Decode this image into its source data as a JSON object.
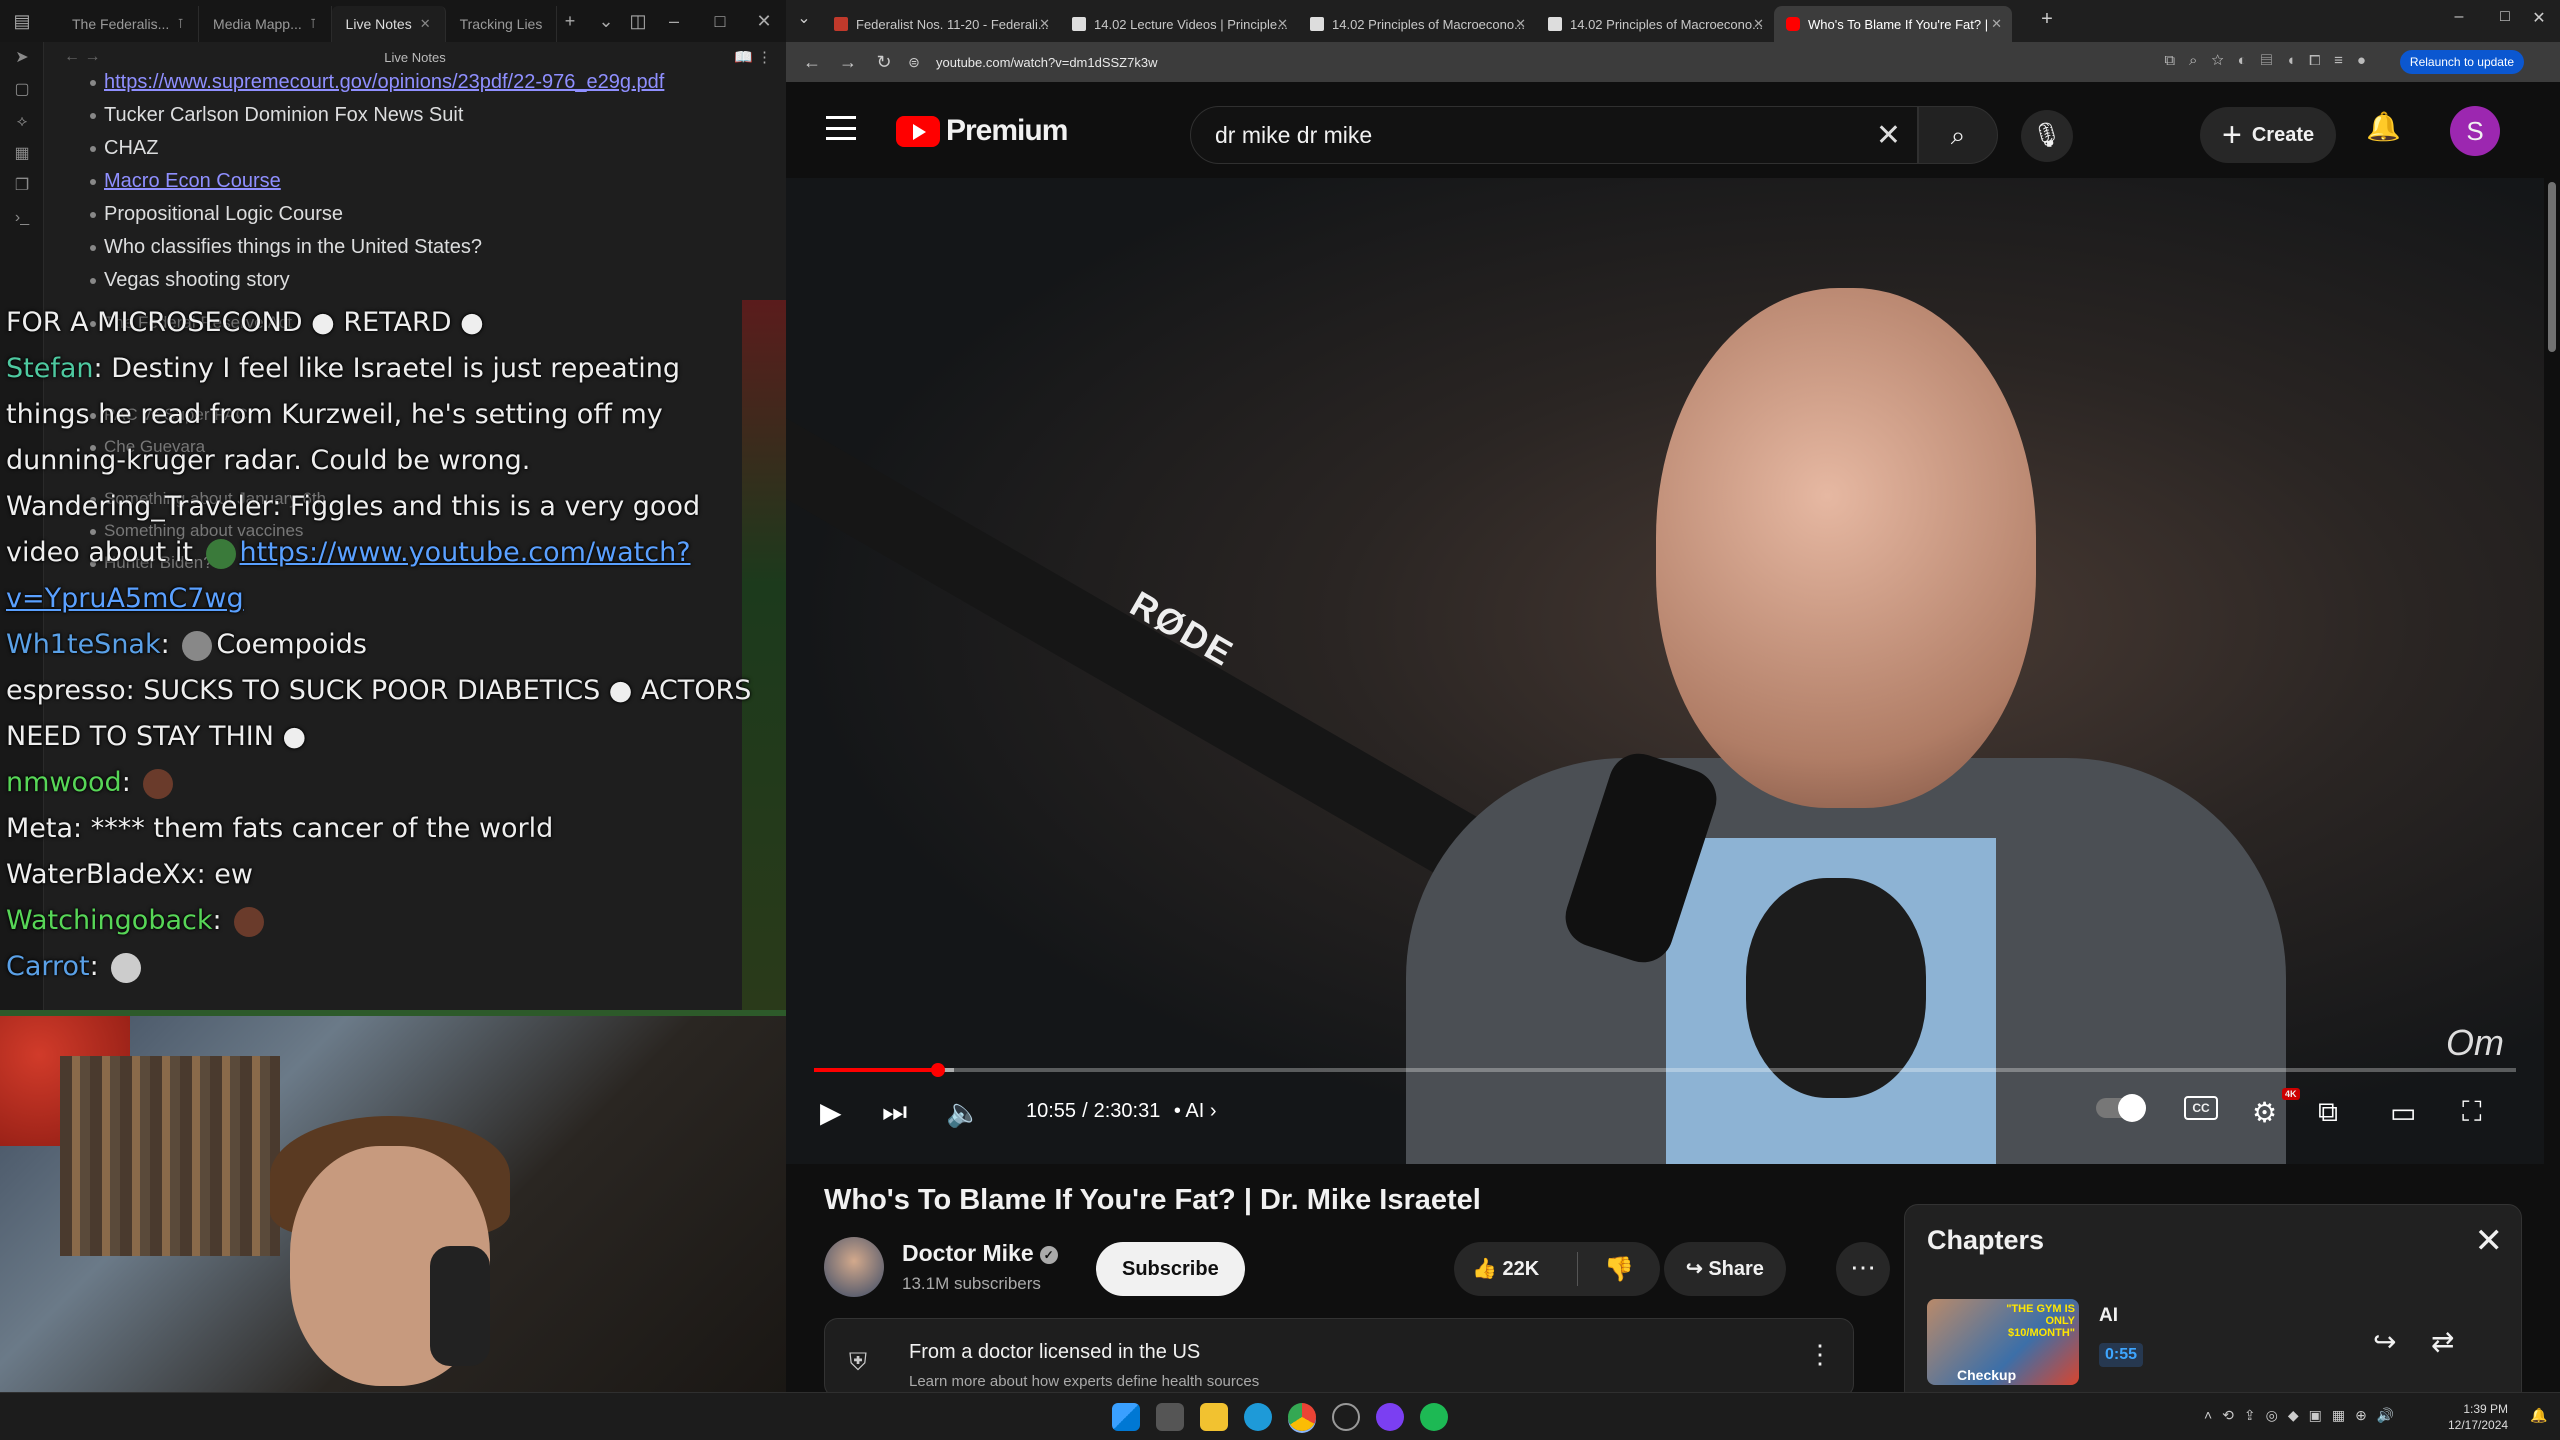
{
  "obsidian": {
    "tabs": [
      {
        "label": "The Federalis...",
        "pinned": true
      },
      {
        "label": "Media Mapp...",
        "pinned": true
      },
      {
        "label": "Live Notes",
        "active": true
      },
      {
        "label": "Tracking Lies"
      }
    ],
    "note_title": "Live Notes",
    "notes": [
      {
        "text": "https://www.supremecourt.gov/opinions/23pdf/22-976_e29g.pdf",
        "link": true
      },
      {
        "text": "Tucker Carlson Dominion Fox News Suit"
      },
      {
        "text": "CHAZ"
      },
      {
        "text": "Macro Econ Course",
        "link": true
      },
      {
        "text": "Propositional Logic Course"
      },
      {
        "text": "Who classifies things in the United States?"
      },
      {
        "text": "Vegas shooting story"
      }
    ],
    "faded_notes": [
      "The Federal Reserve Act",
      "PAC vs Super PAC",
      "Che Guevara",
      "Something about January 6th",
      "Something about vaccines",
      "Hunter Biden?"
    ]
  },
  "stream_chat": [
    {
      "user": "",
      "message": "FOR A MICROSECOND ● RETARD ●"
    },
    {
      "user": "Stefan",
      "message": "Destiny I feel like Israetel is just repeating things he read from Kurzweil, he's setting off my dunning-kruger radar. Could be wrong."
    },
    {
      "user": "Wandering_Traveler",
      "message": "Figgles and this is a very good video about it",
      "link": "https://www.youtube.com/watch?v=YpruA5mC7wg"
    },
    {
      "user": "Wh1teSnak",
      "message": "Coempoids"
    },
    {
      "user": "espresso",
      "message": "SUCKS TO SUCK POOR DIABETICS ● ACTORS NEED TO STAY THIN ●"
    },
    {
      "user": "nmwood",
      "message": ""
    },
    {
      "user": "Meta",
      "message": "**** them fats cancer of the world"
    },
    {
      "user": "WaterBladeXx",
      "message": "ew"
    },
    {
      "user": "Watchingoback",
      "message": ""
    },
    {
      "user": "Carrot",
      "message": ""
    }
  ],
  "chrome": {
    "tabs": [
      {
        "label": "Federalist Nos. 11-20 - Federali...",
        "color": "#c0392b"
      },
      {
        "label": "14.02 Lecture Videos | Principle...",
        "color": "#e0e0e0"
      },
      {
        "label": "14.02 Principles of Macroecono...",
        "color": "#e0e0e0"
      },
      {
        "label": "14.02 Principles of Macroecono...",
        "color": "#e0e0e0"
      },
      {
        "label": "Who's To Blame If You're Fat? |",
        "color": "#ff0000",
        "active": true
      }
    ],
    "url": "youtube.com/watch?v=dm1dSSZ7k3w",
    "relaunch": "Relaunch to update"
  },
  "youtube": {
    "logo": "Premium",
    "search_query": "dr mike dr mike",
    "create": "Create",
    "avatar": "S",
    "player": {
      "current_time": "10:55",
      "duration": "2:30:31",
      "progress": 0.0726,
      "chapter": "AI",
      "mic_brand": "RØDE",
      "quality_badge": "4K"
    },
    "video_title": "Who's To Blame If You're Fat? | Dr. Mike Israetel",
    "channel": "Doctor Mike",
    "subscribers": "13.1M subscribers",
    "subscribe": "Subscribe",
    "likes": "22K",
    "share": "Share",
    "banner": {
      "title": "From a doctor licensed in the US",
      "subtitle": "Learn more about how experts define health sources"
    },
    "chapters_panel": {
      "heading": "Chapters",
      "item_title": "AI",
      "item_time": "0:55",
      "thumb_text": "\"THE GYM IS ONLY $10/MONTH\"",
      "thumb_sub": "Checkup"
    }
  },
  "taskbar": {
    "time": "1:39 PM",
    "date": "12/17/2024"
  }
}
